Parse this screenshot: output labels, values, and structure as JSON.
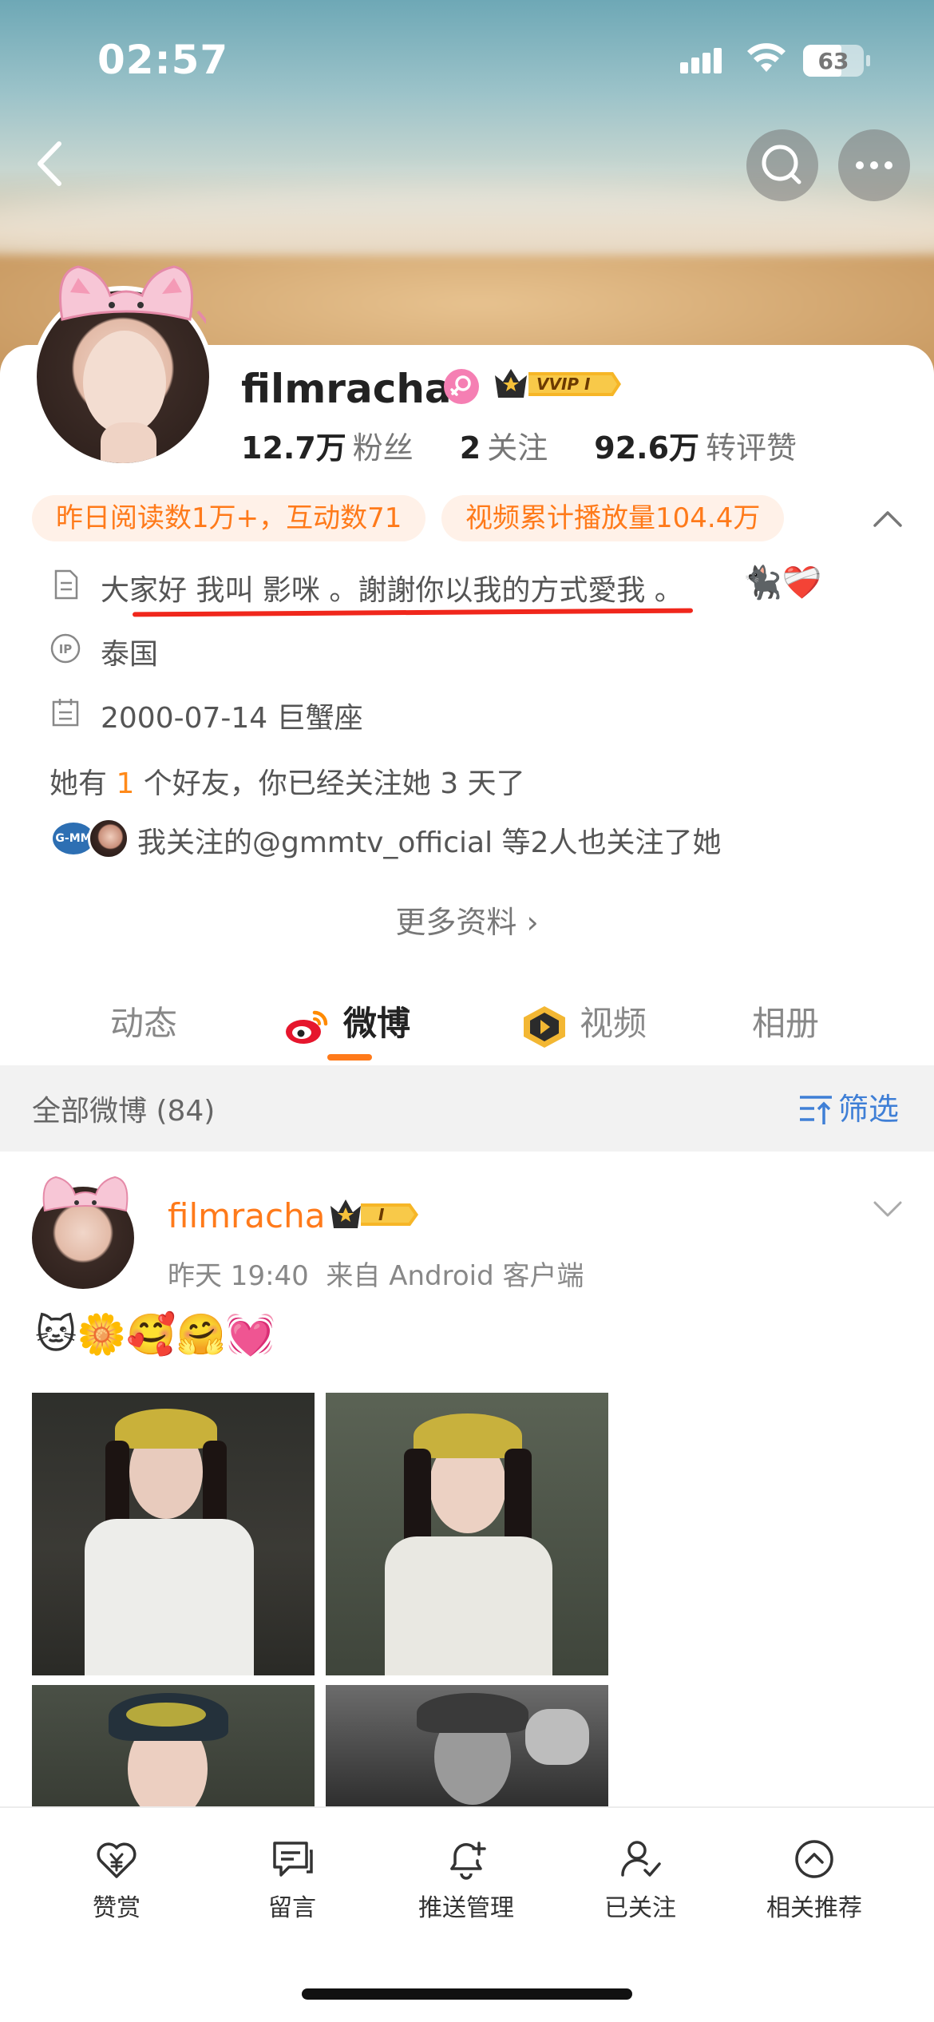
{
  "status_bar": {
    "time": "02:57",
    "battery": "63"
  },
  "profile": {
    "username": "filmracha",
    "vip_label": "VVIP I",
    "stats": [
      {
        "num": "12.7万",
        "label": "粉丝"
      },
      {
        "num": "2",
        "label": "关注"
      },
      {
        "num": "92.6万",
        "label": "转评赞"
      }
    ],
    "pills": [
      "昨日阅读数1万+，互动数71",
      "视频累计播放量104.4万"
    ],
    "bio": "大家好 我叫 影咪 。謝謝你以我的方式愛我 。",
    "bio_emoji": "🐈‍⬛❤️‍🩹",
    "ip_label": "IP",
    "ip": "泰国",
    "birthday": "2000-07-14 巨蟹座",
    "friends_prefix": "她有 ",
    "friends_count": "1",
    "friends_suffix": " 个好友，你已经关注她 3 天了",
    "followed_by": "我关注的@gmmtv_official 等2人也关注了她",
    "followed_by_logo": "G-MM",
    "more_info": "更多资料 ›"
  },
  "tabs": [
    {
      "label": "动态",
      "active": false
    },
    {
      "label": "微博",
      "active": true
    },
    {
      "label": "视频",
      "active": false
    },
    {
      "label": "相册",
      "active": false
    }
  ],
  "feed_header": {
    "all_label": "全部微博 (84)",
    "filter_label": "筛选"
  },
  "post": {
    "author": "filmracha",
    "badge_label": "I",
    "time": "昨天 19:40",
    "source": "来自 Android 客户端",
    "emojis": "🐱🌼🥰🤗💓"
  },
  "bottom_bar": [
    {
      "label": "赞赏",
      "icon": "heart-yen-icon"
    },
    {
      "label": "留言",
      "icon": "chat-bubble-icon"
    },
    {
      "label": "推送管理",
      "icon": "bell-plus-icon"
    },
    {
      "label": "已关注",
      "icon": "user-check-icon"
    },
    {
      "label": "相关推荐",
      "icon": "circle-up-icon"
    }
  ],
  "colors": {
    "accent": "#ff7a1a",
    "link_blue": "#3f7fd6",
    "underline_red": "#f0271c"
  }
}
